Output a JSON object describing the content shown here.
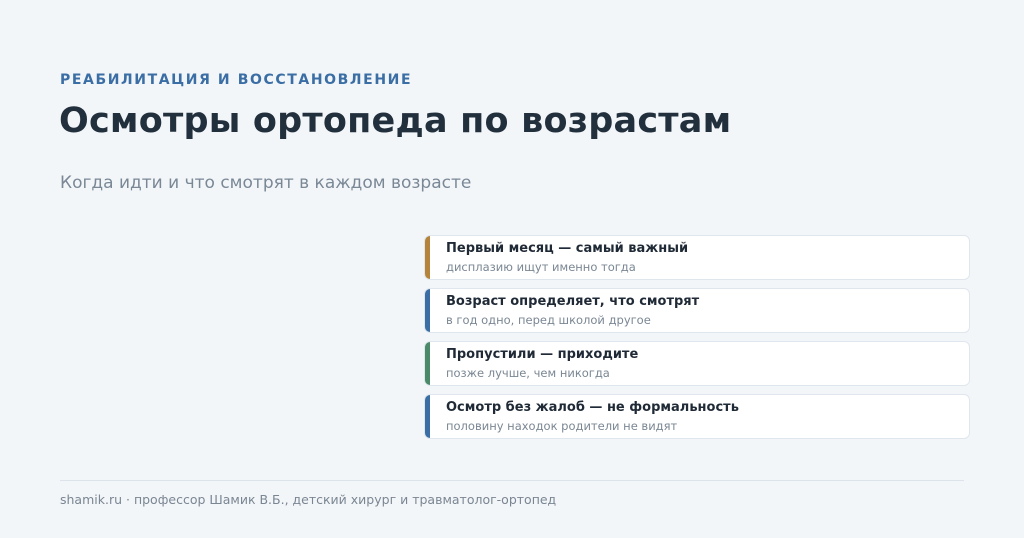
{
  "header": {
    "eyebrow": "РЕАБИЛИТАЦИЯ И ВОССТАНОВЛЕНИЕ",
    "title": "Осмотры ортопеда по возрастам",
    "subtitle": "Когда идти и что смотрят в каждом возрасте"
  },
  "cards": [
    {
      "title": "Первый месяц — самый важный",
      "subtitle": "дисплазию ищут именно тогда",
      "accent": "#b5843a"
    },
    {
      "title": "Возраст определяет, что смотрят",
      "subtitle": "в год одно, перед школой другое",
      "accent": "#3a6ea5"
    },
    {
      "title": "Пропустили — приходите",
      "subtitle": "позже лучше, чем никогда",
      "accent": "#4a8a68"
    },
    {
      "title": "Осмотр без жалоб — не формальность",
      "subtitle": "половину находок родители не видят",
      "accent": "#3a6ea5"
    }
  ],
  "footer": {
    "text": "shamik.ru · профессор Шамик В.Б., детский хирург и травматолог-ортопед"
  }
}
